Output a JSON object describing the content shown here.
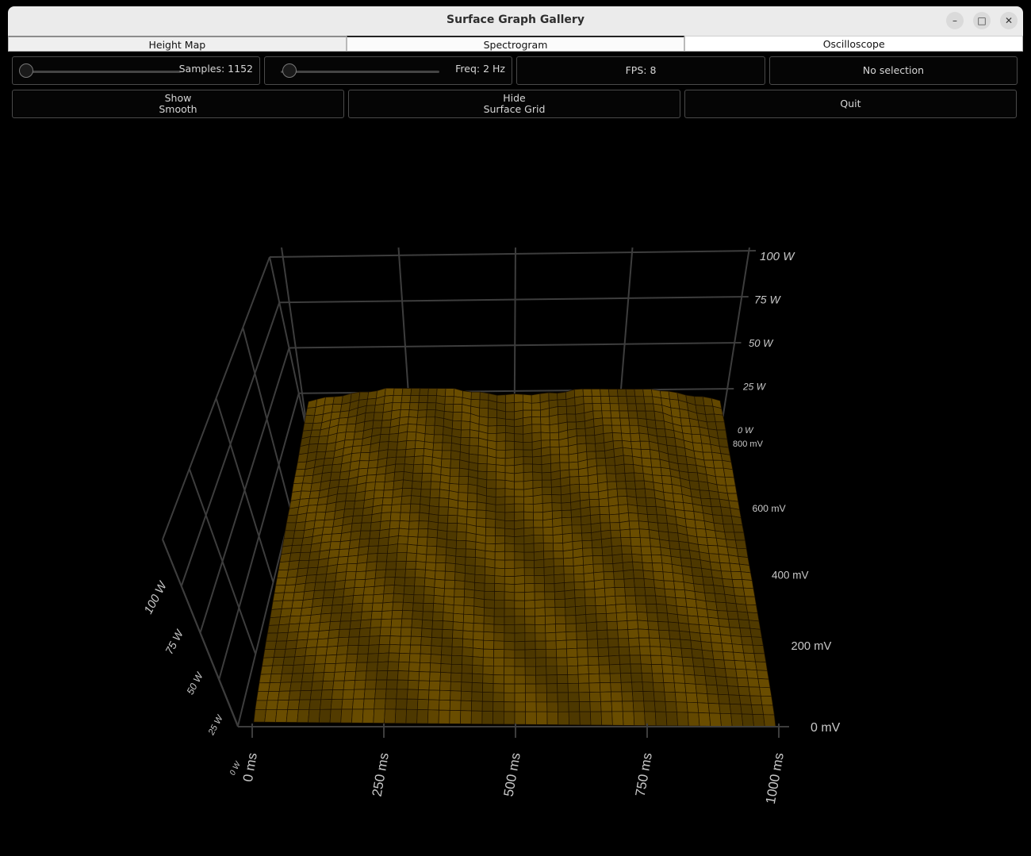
{
  "window": {
    "title": "Surface Graph Gallery",
    "minimize_glyph": "–",
    "maximize_glyph": "□",
    "close_glyph": "✕"
  },
  "tabs": [
    {
      "label": "Height Map"
    },
    {
      "label": "Spectrogram"
    },
    {
      "label": "Oscilloscope"
    }
  ],
  "controls": {
    "samples_label": "Samples: 1152",
    "freq_label": "Freq: 2 Hz",
    "fps_label": "FPS: 8",
    "selection_label": "No selection",
    "smooth_line1": "Show",
    "smooth_line2": "Smooth",
    "grid_line1": "Hide",
    "grid_line2": "Surface Grid",
    "quit_label": "Quit"
  },
  "colors": {
    "surface": "#6a4d00",
    "surface_grid": "#1e1200",
    "axis_grid": "#3d3d3d",
    "label_text": "#c8c8c8"
  },
  "chart_data": {
    "type": "surface",
    "x_ticks": [
      "0 ms",
      "250 ms",
      "500 ms",
      "750 ms",
      "1000 ms"
    ],
    "y_ticks": [
      "0 W",
      "25 W",
      "50 W",
      "75 W",
      "100 W"
    ],
    "z_ticks": [
      "0 mV",
      "200 mV",
      "400 mV",
      "600 mV",
      "800 mV"
    ],
    "xlim": [
      0,
      1000
    ],
    "ylim": [
      0,
      100
    ],
    "zlim": [
      0,
      800
    ],
    "ridge_profile": {
      "x": [
        0,
        50,
        100,
        150,
        200,
        250,
        300,
        350,
        400,
        450,
        500,
        550,
        600,
        650,
        700,
        750,
        800,
        850,
        900,
        950,
        1000
      ],
      "z": [
        600,
        640,
        700,
        760,
        810,
        850,
        840,
        800,
        760,
        700,
        690,
        710,
        740,
        790,
        840,
        880,
        860,
        800,
        720,
        660,
        620
      ]
    },
    "grid_on": true
  }
}
